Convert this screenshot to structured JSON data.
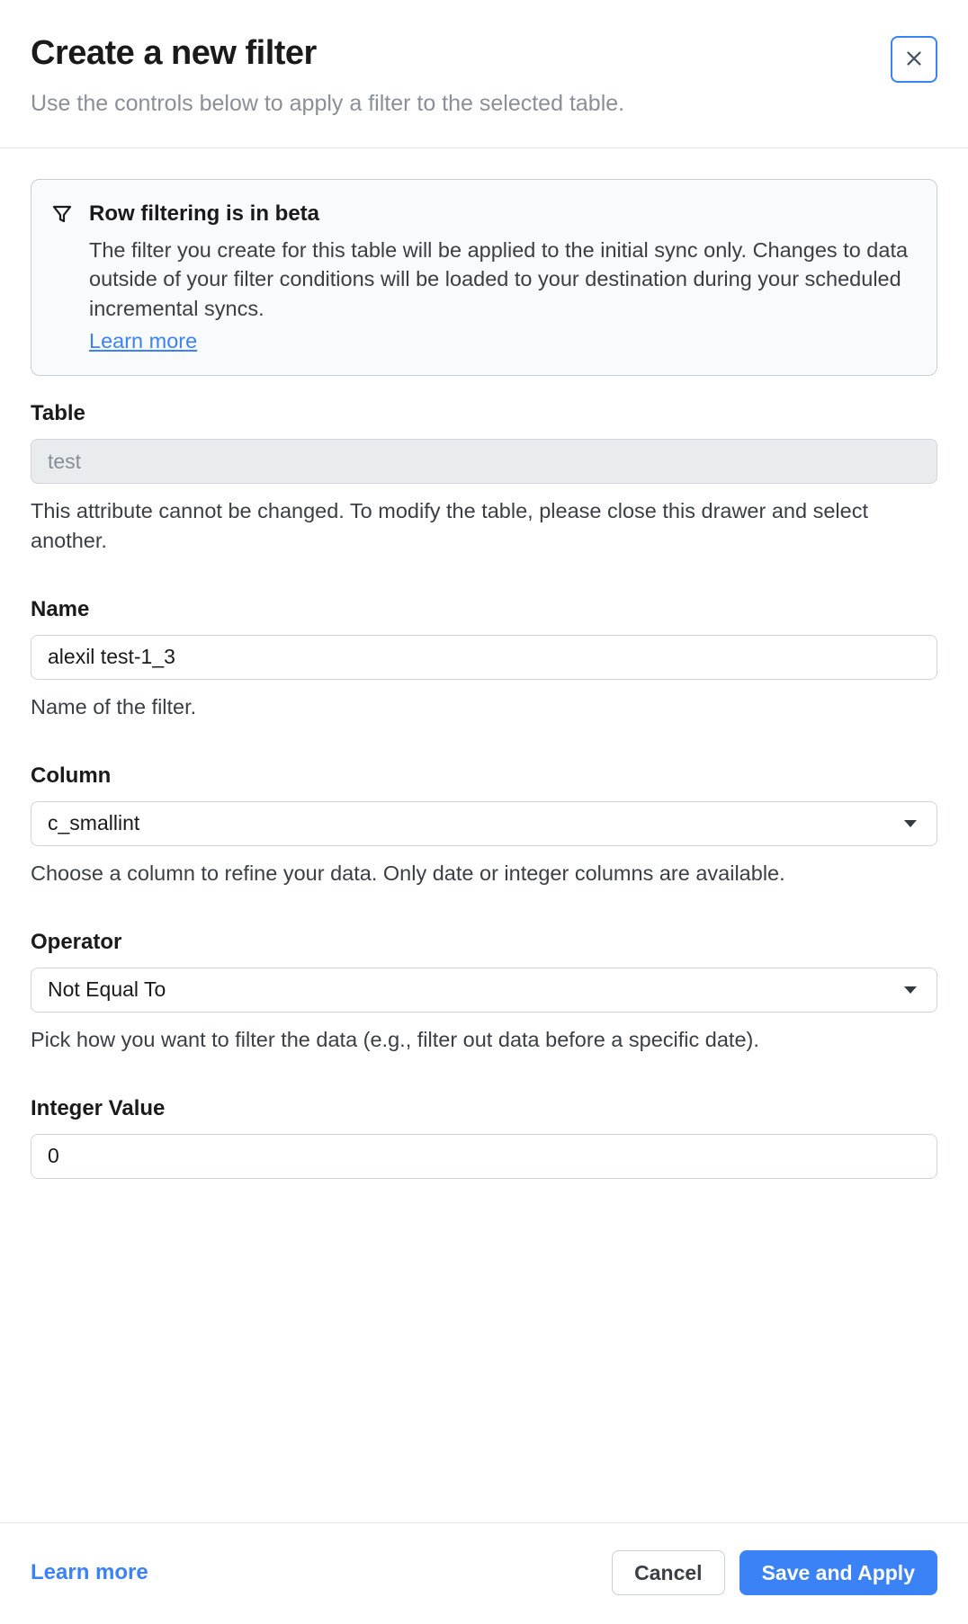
{
  "header": {
    "title": "Create a new filter",
    "subtitle": "Use the controls below to apply a filter to the selected table."
  },
  "notice": {
    "title": "Row filtering is in beta",
    "body": "The filter you create for this table will be applied to the initial sync only. Changes to data outside of your filter conditions will be loaded to your destination during your scheduled incremental syncs.",
    "learn_more": "Learn more"
  },
  "form": {
    "table": {
      "label": "Table",
      "value": "test",
      "help": "This attribute cannot be changed. To modify the table, please close this drawer and select another."
    },
    "name": {
      "label": "Name",
      "value": "alexil test-1_3",
      "help": "Name of the filter."
    },
    "column": {
      "label": "Column",
      "value": "c_smallint",
      "help": "Choose a column to refine your data. Only date or integer columns are available."
    },
    "operator": {
      "label": "Operator",
      "value": "Not Equal To",
      "help": "Pick how you want to filter the data (e.g., filter out data before a specific date)."
    },
    "integer_value": {
      "label": "Integer Value",
      "value": "0"
    }
  },
  "footer": {
    "learn_more": "Learn more",
    "cancel": "Cancel",
    "save": "Save and Apply"
  }
}
